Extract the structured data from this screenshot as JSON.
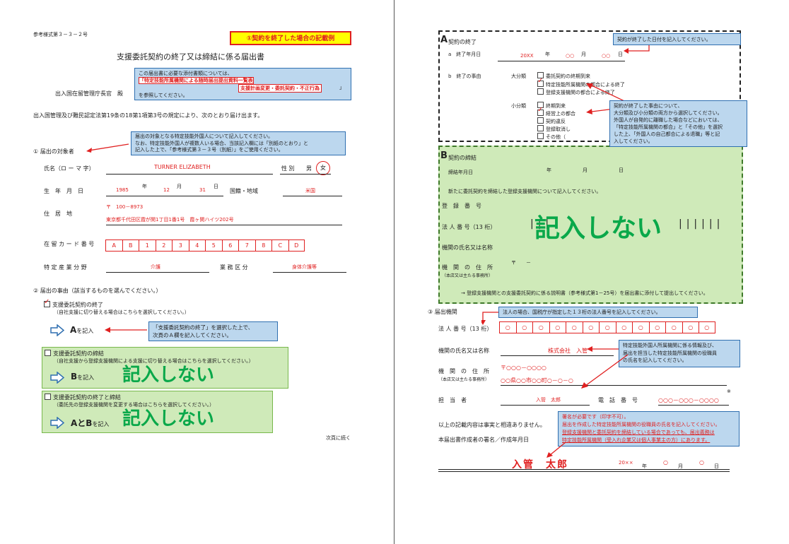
{
  "left": {
    "ref_code": "参考様式第３－３－２号",
    "example_badge": "①契約を終了した場合の記載例",
    "title": "支援委託契約の終了又は締結に係る届出書",
    "addressee": "出入国在留管理庁長官　殿",
    "info_box": {
      "line1": "この届出書に必要な添付書類については、",
      "red1": "「特定技能所属機関による随時届出提出資料一覧表",
      "red2": "支援計画変更・委託契約・不正行為",
      "line3": "を参照してください。",
      "bracket": "」"
    },
    "intro": "出入国管理及び難民認定法第19条の18第1項第3号の規定により、次のとおり届け出ます。",
    "section1": {
      "heading": "①  届出の対象者",
      "note": [
        "届出の対象となる特定技能外国人について記入してください。",
        "なお、特定技能外国人が複数人いる場合、当該記入欄には「別紙のとおり」と",
        "記入した上で、「参考様式第３－３号（別紙）」をご使用ください。"
      ],
      "name_label": "氏名（ロ ー マ 字）",
      "name_value": "TURNER  ELIZABETH",
      "sex_label": "性 別",
      "sex_male": "男",
      "sex_female": "女",
      "dob_label": "生　年　月　日",
      "dob_year": "1985",
      "dob_year_label": "年",
      "dob_month": "12",
      "dob_month_label": "月",
      "dob_day": "31",
      "dob_day_label": "日",
      "nation_label": "国籍・地域",
      "nation_value": "米国",
      "address_label": "住　居　地",
      "postal": "〒　100－8973",
      "address": "東京都千代田区霞が関1丁目1番1号　霞ヶ関ハイツ202号",
      "card_label": "在 留 カ ー ド 番 号",
      "card_cells": [
        "A",
        "B",
        "1",
        "2",
        "3",
        "4",
        "5",
        "6",
        "7",
        "8",
        "C",
        "D"
      ],
      "field_label": "特 定 産 業 分 野",
      "field_value": "介護",
      "category_label": "業 務 区 分",
      "category_value": "身体介護等"
    },
    "section2": {
      "heading": "②  届出の事由（該当するものを選んでください。）",
      "opt1": "支援委託契約の終了",
      "opt1_sub": "（自社支援に切り替える場合はこちらを選択してください。）",
      "opt1_fill_letter": "A",
      "opt1_fill": "を記入",
      "opt1_note": [
        "「支援委託契約の終了」を選択した上で、",
        "次頁のＡ欄を記入してください。"
      ],
      "opt2": "支援委託契約の締結",
      "opt2_sub": "（自社支援から登録支援機関による支援に切り替える場合はこちらを選択してください。）",
      "opt2_fill_letter": "B",
      "opt2_fill": "を記入",
      "opt3": "支援委託契約の終了と締結",
      "opt3_sub": "（委託先の登録支援機関を変更する場合はこちらを選択してください。）",
      "opt3_fill_letter": "AとB",
      "opt3_fill": "を記入",
      "do_not_fill": "記入しない"
    },
    "continue": "次頁に続く"
  },
  "right": {
    "sectionA": {
      "letter": "A",
      "title": "契約の終了",
      "date_label": "a　終了年月日",
      "date_year": "20XX",
      "date_y_l": "年",
      "date_month": "○○",
      "date_m_l": "月",
      "date_day": "○○",
      "date_d_l": "日",
      "date_note": "契約が終了した日付を記入してください。",
      "reason_label": "b　終了の事由",
      "major_label": "大分類",
      "major": [
        "委託契約の終期到来",
        "特定技能所属機関の都合による終了",
        "登録支援機関の都合による終了"
      ],
      "minor_label": "小分類",
      "minor": [
        "終期到来",
        "経営上の都合",
        "契約違反",
        "登録取消し",
        "その他（"
      ],
      "reason_note": [
        "契約が終了した事由について、",
        "大分類及び小分類の両方から選択してください。",
        "外国人が自発的に離職した場合などにおいては、",
        "「特定技能所属機関の都合」と「その他」を選択",
        "した上、「外国人の自己都合による退職」等と記",
        "入してください。"
      ]
    },
    "sectionB": {
      "letter": "B",
      "title": "契約の締結",
      "date_label": "締結年月日",
      "y": "年",
      "m": "月",
      "d": "日",
      "intro": "新たに委託契約を締結した登録支援機関について記入してください。",
      "reg_label": "登　録　番　号",
      "corp_label": "法 人 番 号（13 桁）",
      "name_label": "機関の氏名又は名称",
      "addr_label": "機　関　の　住　所",
      "addr_sub": "（本店又は主たる事務所）",
      "postal": "〒　　－",
      "footer": "→ 登録支援機関との支援委託契約に係る説明書（参考様式第1－25号）を届出書に添付して提出してください。",
      "do_not_fill": "記入しない"
    },
    "section3": {
      "heading": "③  届出機関",
      "corp_note": "法人の場合、国税庁が指定した１３桁の法人番号を記入してください。",
      "corp_label": "法 人 番 号（13 桁）",
      "corp_cells": [
        "○",
        "○",
        "○",
        "○",
        "○",
        "○",
        "○",
        "○",
        "○",
        "○",
        "○",
        "○",
        "○"
      ],
      "name_label": "機関の氏名又は名称",
      "name_value": "株式会社　入管",
      "name_note": [
        "特定技能外国人所属機関に係る情報及び、",
        "届出を担当した特定技能所属機関の役職員",
        "の氏名を記入してください。"
      ],
      "addr_label": "機　関　の　住　所",
      "addr_sub": "（本店又は主たる事務所）",
      "postal": "〒○○○－○○○○",
      "address": "○○県○○市○○町○－○－○",
      "person_label": "担　当　者",
      "person_value": "入管　太郎",
      "tel_label": "電　話　番　号",
      "tel_value": "○○○－○○○－○○○○",
      "asterisk": "※",
      "sign_note": [
        "署名が必要です（印字不可）。",
        "届出を作成した特定技能所属機関の役職員の氏名を記入してください。",
        "登録支援機関と委託契約を締結している場合であっても、届出義務は",
        "特定技能所属機関（受入れ企業又は個人事業主の方）にあります。"
      ],
      "declaration": "以上の記載内容は事実と相違ありません。",
      "signer_label": "本届出書作成者の署名／作成年月日",
      "signature": "入管　太郎",
      "sign_year": "20××",
      "sign_y_l": "年",
      "sign_month": "○",
      "sign_m_l": "月",
      "sign_day": "○",
      "sign_d_l": "日"
    }
  },
  "colors": {
    "red": "#e02020",
    "blue_box": "#bcd7ee",
    "green_box": "#cfeab9",
    "green_text": "#0aa84a",
    "badge_bg": "#ffff00"
  }
}
